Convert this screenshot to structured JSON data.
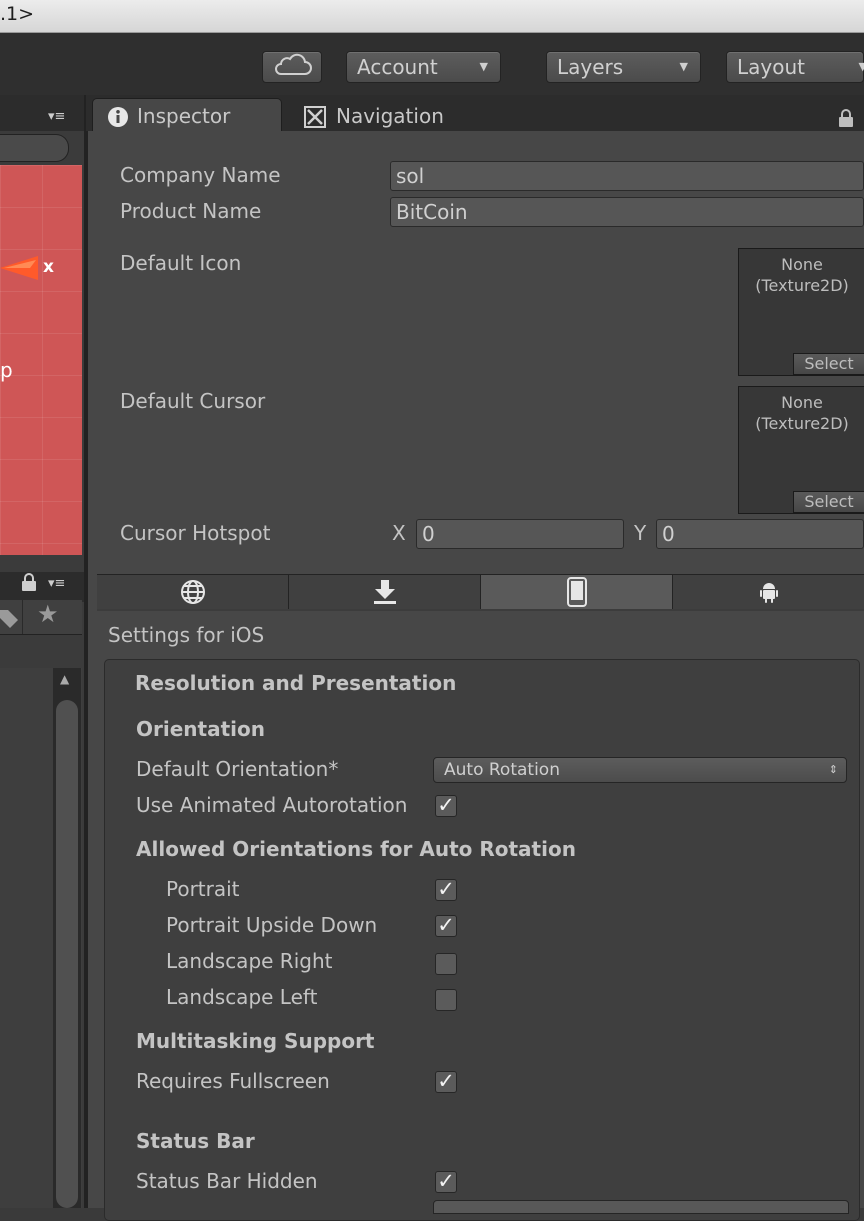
{
  "window": {
    "title_fragment": ".1>"
  },
  "toolbar": {
    "cloud_icon": "cloud-icon",
    "account_label": "Account",
    "layers_label": "Layers",
    "layout_label": "Layout"
  },
  "left_panel": {
    "scene_gizmo_label": "x",
    "scene_edge_text": "p"
  },
  "tabs": {
    "inspector_label": "Inspector",
    "navigation_label": "Navigation"
  },
  "player_settings": {
    "company_name_label": "Company Name",
    "company_name_value": "sol",
    "product_name_label": "Product Name",
    "product_name_value": "BitCoin",
    "default_icon_label": "Default Icon",
    "default_cursor_label": "Default Cursor",
    "object_field_none": "None",
    "object_field_type": "(Texture2D)",
    "select_label": "Select",
    "cursor_hotspot_label": "Cursor Hotspot",
    "x_label": "X",
    "x_value": "0",
    "y_label": "Y",
    "y_value": "0"
  },
  "platform_tabs": [
    "globe-icon",
    "download-icon",
    "mobile-phone-icon",
    "android-icon"
  ],
  "ios": {
    "settings_for": "Settings for iOS",
    "section_title": "Resolution and Presentation",
    "orientation_header": "Orientation",
    "default_orientation_label": "Default Orientation*",
    "default_orientation_value": "Auto Rotation",
    "use_animated_label": "Use Animated Autorotation",
    "use_animated_checked": true,
    "allowed_header": "Allowed Orientations for Auto Rotation",
    "portrait_label": "Portrait",
    "portrait_checked": true,
    "portrait_upside_label": "Portrait Upside Down",
    "portrait_upside_checked": true,
    "landscape_right_label": "Landscape Right",
    "landscape_right_checked": false,
    "landscape_left_label": "Landscape Left",
    "landscape_left_checked": false,
    "multitasking_header": "Multitasking Support",
    "requires_fullscreen_label": "Requires Fullscreen",
    "requires_fullscreen_checked": true,
    "status_bar_header": "Status Bar",
    "status_bar_hidden_label": "Status Bar Hidden",
    "status_bar_hidden_checked": true
  },
  "colors": {
    "scene_background": "#cf5656",
    "inspector_background": "#474747",
    "toolbar_background": "#2f2f2f"
  }
}
